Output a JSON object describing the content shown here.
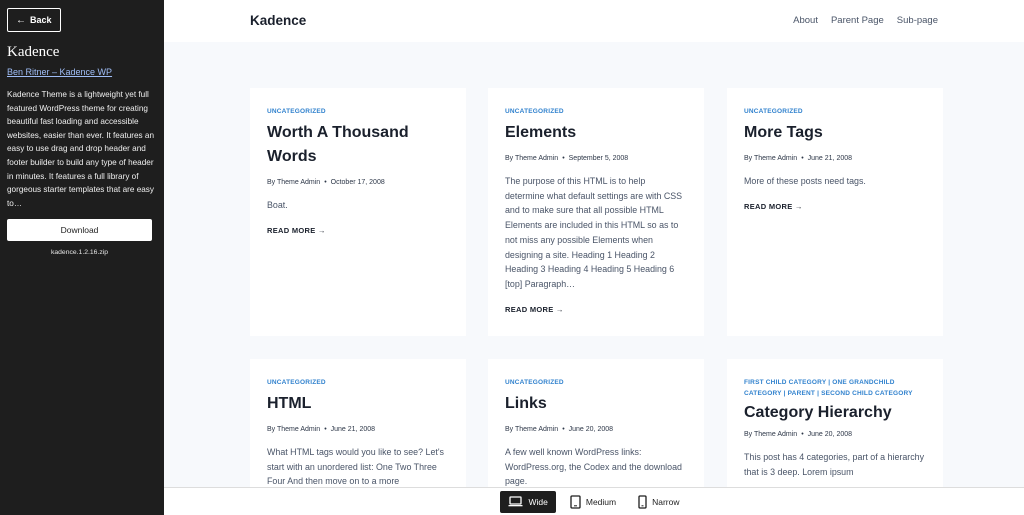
{
  "sidebar": {
    "back_label": "Back",
    "theme_name": "Kadence",
    "author_link": "Ben Ritner – Kadence WP",
    "description": "Kadence Theme is a lightweight yet full featured WordPress theme for creating beautiful fast loading and accessible websites, easier than ever. It features an easy to use drag and drop header and footer builder to build any type of header in minutes. It features a full library of gorgeous starter templates that are easy to…",
    "download_label": "Download",
    "zip_name": "kadence.1.2.16.zip"
  },
  "header": {
    "logo": "Kadence",
    "nav": [
      "About",
      "Parent Page",
      "Sub-page"
    ]
  },
  "posts": [
    {
      "category": "UNCATEGORIZED",
      "title": "Worth A Thousand Words",
      "author": "By Theme Admin",
      "date": "October 17, 2008",
      "excerpt": "Boat.",
      "more": "READ MORE →"
    },
    {
      "category": "UNCATEGORIZED",
      "title": "Elements",
      "author": "By Theme Admin",
      "date": "September 5, 2008",
      "excerpt": "The purpose of this HTML is to help determine what default settings are with CSS and to make sure that all possible HTML Elements are included in this HTML so as to not miss any possible Elements when designing a site. Heading 1 Heading 2 Heading 3 Heading 4 Heading 5 Heading 6 [top] Paragraph…",
      "more": "READ MORE →"
    },
    {
      "category": "UNCATEGORIZED",
      "title": "More Tags",
      "author": "By Theme Admin",
      "date": "June 21, 2008",
      "excerpt": "More of these posts need tags.",
      "more": "READ MORE →"
    },
    {
      "category": "UNCATEGORIZED",
      "title": "HTML",
      "author": "By Theme Admin",
      "date": "June 21, 2008",
      "excerpt": "What HTML tags would you like to see? Let's start with an unordered list: One Two Three Four And then move on to a more",
      "more": ""
    },
    {
      "category": "UNCATEGORIZED",
      "title": "Links",
      "author": "By Theme Admin",
      "date": "June 20, 2008",
      "excerpt": "A few well known WordPress links: WordPress.org, the Codex and the download page.",
      "more": ""
    },
    {
      "category": "FIRST CHILD CATEGORY | ONE GRANDCHILD CATEGORY | PARENT | SECOND CHILD CATEGORY",
      "title": "Category Hierarchy",
      "author": "By Theme Admin",
      "date": "June 20, 2008",
      "excerpt": "This post has 4 categories, part of a hierarchy that is 3 deep. Lorem ipsum",
      "more": ""
    }
  ],
  "device_bar": {
    "wide": "Wide",
    "medium": "Medium",
    "narrow": "Narrow",
    "active": "Wide"
  }
}
